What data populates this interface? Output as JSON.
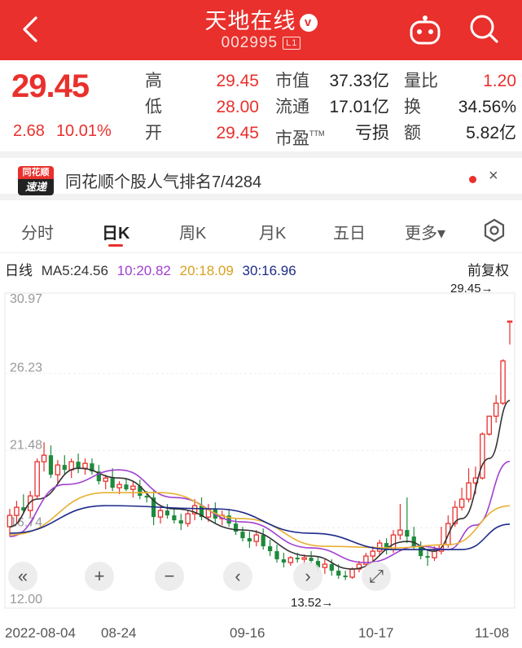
{
  "header": {
    "title": "天地在线",
    "verified_badge": "v",
    "code": "002995",
    "level_tag": "L1"
  },
  "quote": {
    "price": "29.45",
    "change": "2.68",
    "change_pct": "10.01%",
    "col1": [
      {
        "label": "高",
        "value": "29.45"
      },
      {
        "label": "低",
        "value": "28.00"
      },
      {
        "label": "开",
        "value": "29.45"
      }
    ],
    "col2": [
      {
        "label": "市值",
        "value": "37.33亿"
      },
      {
        "label": "流通",
        "value": "17.01亿"
      },
      {
        "label": "市盈",
        "label_sup": "TTM",
        "value": "亏损"
      }
    ],
    "col3": [
      {
        "label": "量比",
        "value": "1.20"
      },
      {
        "label": "换",
        "value": "34.56%"
      },
      {
        "label": "额",
        "value": "5.82亿"
      }
    ]
  },
  "banner": {
    "logo_top": "同花顺",
    "logo_bottom": "速递",
    "text": "同花顺个股人气排名7/4284",
    "close": "×"
  },
  "tabs": [
    "分时",
    "日K",
    "周K",
    "月K",
    "五日",
    "更多▾"
  ],
  "active_tab": 1,
  "ma_line": {
    "label": "日线",
    "ma5": "MA5:24.56",
    "ma10": "10:20.82",
    "ma20": "20:18.09",
    "ma30": "30:16.96",
    "adjust": "前复权"
  },
  "colors": {
    "up": "#e9302c",
    "down": "#1e8a3c",
    "ma5": "#333333",
    "ma10": "#a03fd0",
    "ma20": "#e8b030",
    "ma30": "#1c2a8a"
  },
  "chart_data": {
    "type": "candlestick",
    "y_ticks": [
      "30.97",
      "26.23",
      "21.48",
      "16.74",
      "12.00"
    ],
    "ylim": [
      12.0,
      30.97
    ],
    "x_ticks": [
      "2022-08-04",
      "08-24",
      "09-16",
      "10-17",
      "11-08"
    ],
    "max_label": "29.45→",
    "min_label": "13.52→",
    "candles": [
      [
        16.8,
        17.9,
        16.2,
        17.5
      ],
      [
        17.5,
        18.4,
        17.0,
        18.0
      ],
      [
        18.0,
        18.8,
        17.6,
        17.8
      ],
      [
        17.8,
        19.0,
        17.4,
        18.7
      ],
      [
        18.7,
        21.0,
        18.5,
        20.8
      ],
      [
        20.8,
        22.0,
        20.2,
        21.2
      ],
      [
        21.2,
        21.8,
        19.8,
        20.0
      ],
      [
        20.0,
        20.9,
        19.5,
        20.6
      ],
      [
        20.6,
        21.2,
        20.0,
        20.3
      ],
      [
        20.3,
        21.0,
        19.8,
        20.8
      ],
      [
        20.8,
        21.3,
        20.1,
        20.4
      ],
      [
        20.4,
        21.0,
        20.0,
        20.7
      ],
      [
        20.7,
        21.0,
        20.0,
        20.2
      ],
      [
        20.2,
        20.6,
        19.4,
        19.6
      ],
      [
        19.6,
        20.0,
        19.1,
        19.8
      ],
      [
        19.8,
        20.4,
        19.0,
        19.2
      ],
      [
        19.2,
        19.6,
        18.8,
        19.4
      ],
      [
        19.4,
        19.8,
        19.0,
        19.1
      ],
      [
        19.1,
        19.6,
        18.6,
        19.3
      ],
      [
        19.3,
        19.7,
        18.5,
        18.7
      ],
      [
        18.7,
        19.0,
        18.3,
        18.6
      ],
      [
        18.6,
        19.0,
        16.9,
        17.4
      ],
      [
        17.4,
        18.0,
        17.0,
        17.8
      ],
      [
        17.8,
        18.2,
        17.3,
        17.5
      ],
      [
        17.5,
        17.9,
        17.0,
        17.2
      ],
      [
        17.2,
        17.6,
        16.6,
        17.0
      ],
      [
        17.0,
        17.8,
        16.8,
        17.6
      ],
      [
        17.6,
        18.5,
        17.2,
        18.1
      ],
      [
        18.1,
        18.6,
        17.2,
        17.4
      ],
      [
        17.4,
        18.2,
        17.1,
        17.9
      ],
      [
        17.9,
        18.3,
        17.0,
        17.3
      ],
      [
        17.3,
        17.8,
        16.9,
        17.5
      ],
      [
        17.5,
        17.9,
        16.8,
        17.0
      ],
      [
        17.0,
        17.3,
        16.3,
        16.5
      ],
      [
        16.5,
        16.8,
        15.9,
        16.1
      ],
      [
        16.1,
        16.5,
        15.5,
        15.9
      ],
      [
        15.9,
        16.6,
        15.6,
        16.3
      ],
      [
        16.3,
        16.7,
        15.4,
        15.6
      ],
      [
        15.6,
        16.0,
        15.0,
        15.3
      ],
      [
        15.3,
        15.7,
        14.6,
        14.8
      ],
      [
        14.8,
        15.2,
        14.3,
        14.6
      ],
      [
        14.6,
        15.0,
        14.4,
        14.9
      ],
      [
        14.9,
        15.2,
        14.6,
        14.8
      ],
      [
        14.8,
        15.1,
        14.5,
        14.9
      ],
      [
        14.9,
        15.3,
        14.5,
        14.7
      ],
      [
        14.7,
        15.0,
        14.1,
        14.3
      ],
      [
        14.3,
        14.8,
        13.9,
        14.5
      ],
      [
        14.5,
        14.8,
        13.8,
        14.1
      ],
      [
        14.1,
        14.5,
        13.6,
        13.8
      ],
      [
        13.8,
        14.1,
        13.52,
        13.7
      ],
      [
        13.7,
        14.3,
        13.6,
        14.2
      ],
      [
        14.2,
        14.7,
        14.0,
        14.5
      ],
      [
        14.5,
        15.2,
        14.3,
        15.0
      ],
      [
        15.0,
        15.6,
        14.7,
        15.3
      ],
      [
        15.3,
        16.0,
        15.0,
        15.8
      ],
      [
        15.8,
        16.1,
        15.1,
        15.4
      ],
      [
        15.4,
        16.6,
        15.2,
        16.3
      ],
      [
        16.3,
        18.2,
        16.0,
        16.6
      ],
      [
        16.6,
        18.6,
        15.8,
        16.2
      ],
      [
        16.2,
        16.8,
        15.4,
        15.6
      ],
      [
        15.6,
        15.9,
        14.8,
        15.0
      ],
      [
        15.0,
        15.4,
        14.4,
        14.9
      ],
      [
        14.9,
        15.6,
        14.7,
        15.3
      ],
      [
        15.3,
        16.8,
        15.1,
        15.7
      ],
      [
        15.7,
        17.5,
        15.5,
        17.0
      ],
      [
        17.0,
        18.4,
        16.8,
        18.0
      ],
      [
        18.0,
        19.2,
        17.8,
        18.5
      ],
      [
        18.5,
        20.4,
        18.3,
        19.5
      ],
      [
        19.5,
        20.5,
        18.8,
        19.8
      ],
      [
        19.8,
        22.6,
        19.7,
        22.5
      ],
      [
        22.5,
        23.6,
        22.4,
        23.6
      ],
      [
        23.6,
        24.9,
        23.2,
        24.4
      ],
      [
        24.4,
        27.1,
        24.3,
        27.0
      ],
      [
        29.45,
        29.45,
        28.0,
        29.45
      ]
    ],
    "ma": {
      "ma5": [
        [
          0,
          16.8
        ],
        [
          4,
          18.5
        ],
        [
          10,
          20.4
        ],
        [
          16,
          19.8
        ],
        [
          24,
          17.9
        ],
        [
          34,
          16.6
        ],
        [
          44,
          15.0
        ],
        [
          50,
          14.2
        ],
        [
          58,
          15.9
        ],
        [
          62,
          15.3
        ],
        [
          66,
          17.3
        ],
        [
          70,
          21.0
        ],
        [
          73,
          24.56
        ]
      ],
      "ma10": [
        [
          0,
          16.2
        ],
        [
          8,
          19.4
        ],
        [
          16,
          20.3
        ],
        [
          24,
          18.6
        ],
        [
          34,
          17.1
        ],
        [
          44,
          15.5
        ],
        [
          52,
          14.6
        ],
        [
          60,
          15.6
        ],
        [
          64,
          15.4
        ],
        [
          68,
          16.9
        ],
        [
          73,
          20.82
        ]
      ],
      "ma20": [
        [
          0,
          16.3
        ],
        [
          14,
          18.9
        ],
        [
          22,
          18.9
        ],
        [
          34,
          17.3
        ],
        [
          46,
          15.6
        ],
        [
          56,
          15.5
        ],
        [
          64,
          15.7
        ],
        [
          73,
          18.09
        ]
      ],
      "ma30": [
        [
          0,
          16.4
        ],
        [
          14,
          18.1
        ],
        [
          30,
          17.9
        ],
        [
          44,
          16.4
        ],
        [
          56,
          15.4
        ],
        [
          66,
          15.4
        ],
        [
          73,
          16.96
        ]
      ]
    }
  },
  "controls": [
    "«",
    "+",
    "−",
    "‹",
    "›",
    "⤢"
  ]
}
